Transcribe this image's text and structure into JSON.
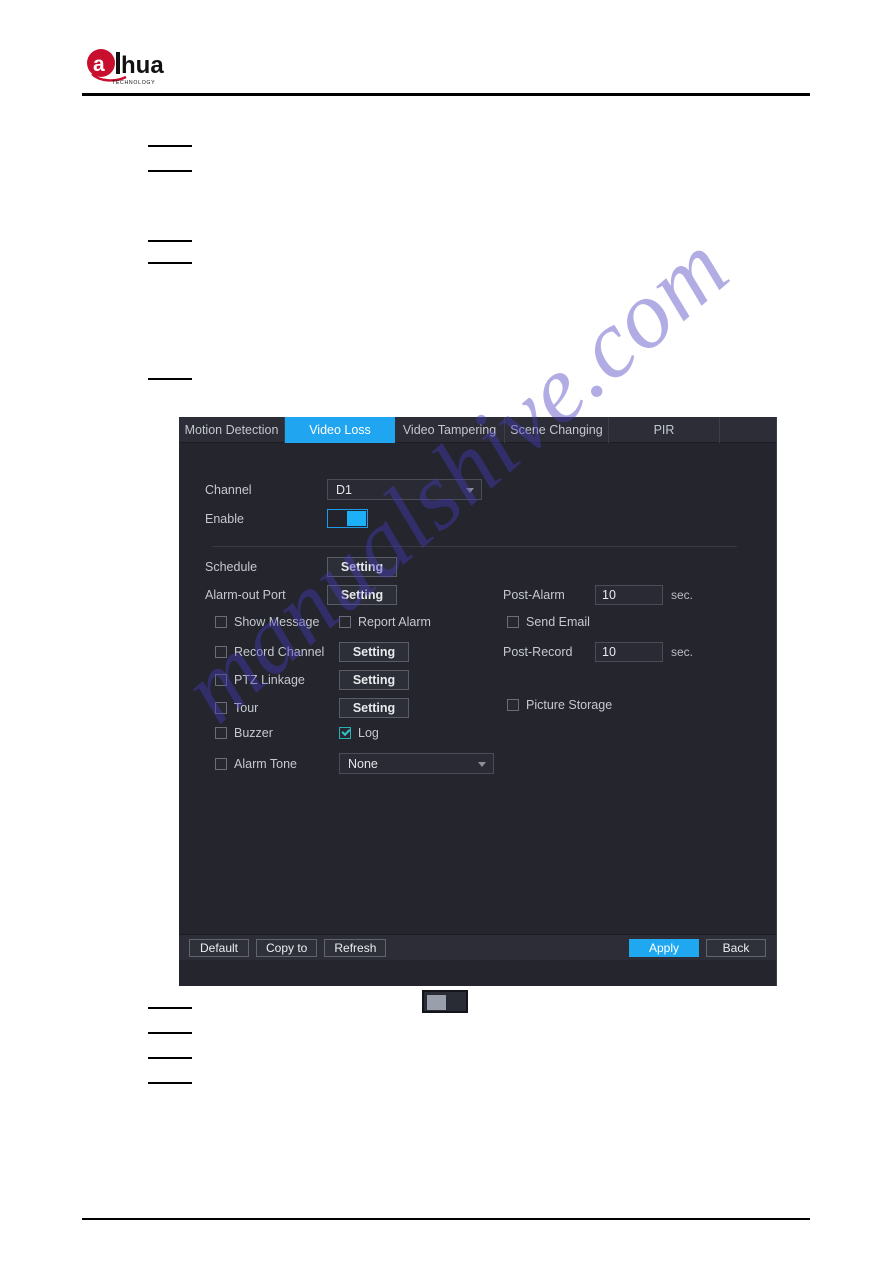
{
  "page": {
    "brand": "alhua",
    "brand_sub": "TECHNOLOGY",
    "watermark": "manualshive.com"
  },
  "dialog": {
    "tabs": [
      {
        "label": "Motion Detection",
        "active": false
      },
      {
        "label": "Video Loss",
        "active": true
      },
      {
        "label": "Video Tampering",
        "active": false
      },
      {
        "label": "Scene Changing",
        "active": false
      },
      {
        "label": "PIR",
        "active": false
      }
    ],
    "fields": {
      "channel_label": "Channel",
      "channel_value": "D1",
      "enable_label": "Enable",
      "schedule_label": "Schedule",
      "schedule_button": "Setting",
      "alarm_out_label": "Alarm-out Port",
      "alarm_out_button": "Setting",
      "post_alarm_label": "Post-Alarm",
      "post_alarm_value": "10",
      "post_alarm_unit": "sec.",
      "show_message_label": "Show Message",
      "report_alarm_label": "Report Alarm",
      "send_email_label": "Send Email",
      "record_channel_label": "Record Channel",
      "record_channel_button": "Setting",
      "post_record_label": "Post-Record",
      "post_record_value": "10",
      "post_record_unit": "sec.",
      "ptz_linkage_label": "PTZ Linkage",
      "ptz_linkage_button": "Setting",
      "tour_label": "Tour",
      "tour_button": "Setting",
      "picture_storage_label": "Picture Storage",
      "buzzer_label": "Buzzer",
      "log_label": "Log",
      "alarm_tone_label": "Alarm Tone",
      "alarm_tone_value": "None"
    },
    "footer": {
      "default_label": "Default",
      "copy_to_label": "Copy to",
      "refresh_label": "Refresh",
      "apply_label": "Apply",
      "back_label": "Back"
    },
    "colors": {
      "accent_blue": "#1fa8ef",
      "panel_bg": "#24252d",
      "tab_bg": "#2c2d36",
      "check_teal": "#2fc4c7"
    }
  }
}
